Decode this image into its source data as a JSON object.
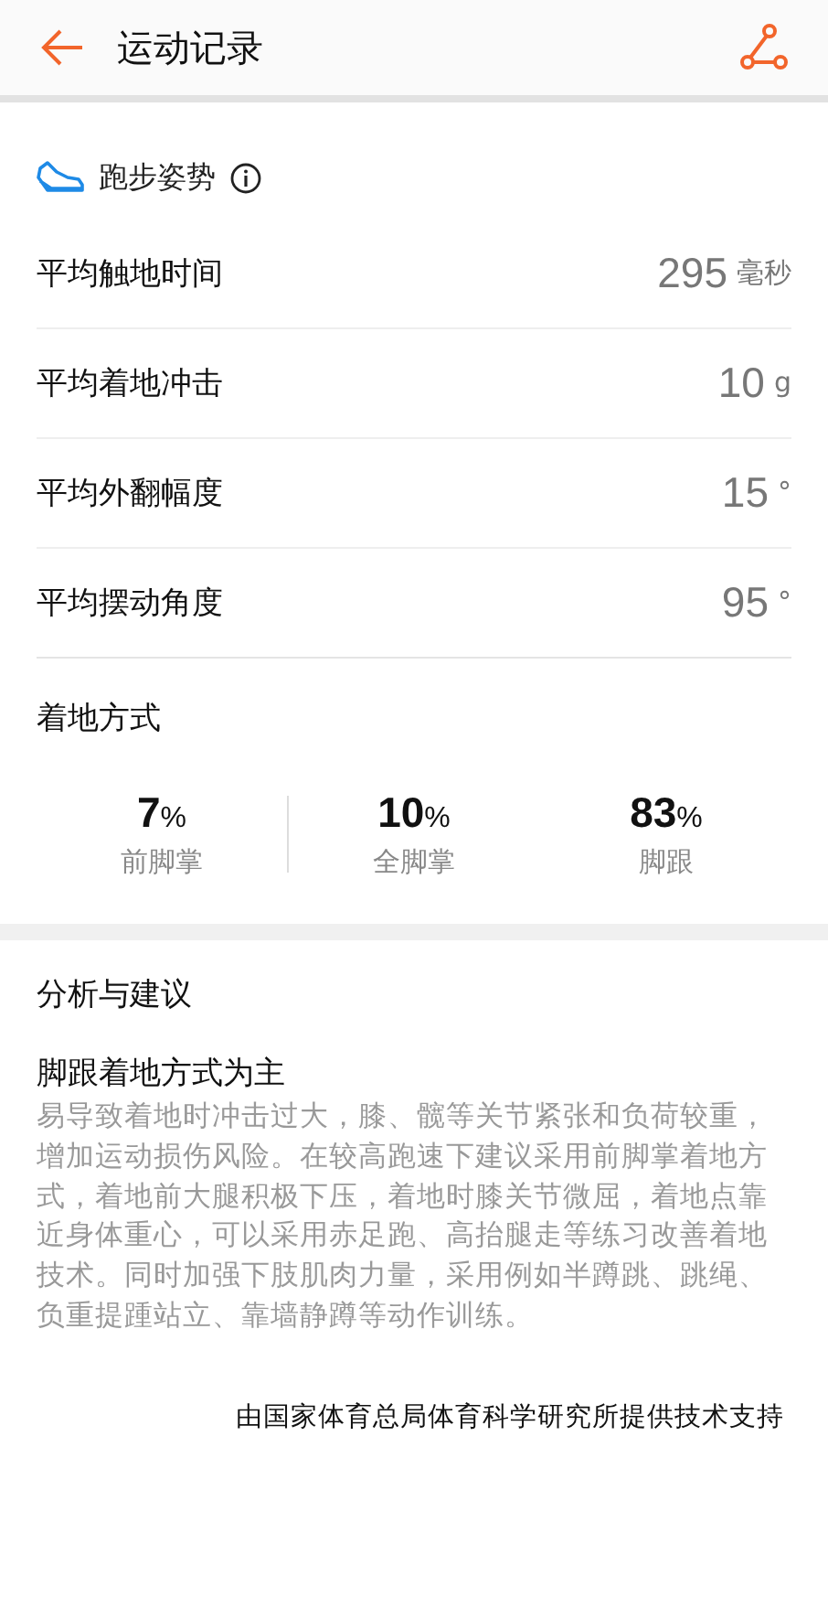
{
  "header": {
    "title": "运动记录"
  },
  "section": {
    "title": "跑步姿势"
  },
  "metrics": [
    {
      "label": "平均触地时间",
      "value": "295",
      "unit": "毫秒"
    },
    {
      "label": "平均着地冲击",
      "value": "10",
      "unit": "g"
    },
    {
      "label": "平均外翻幅度",
      "value": "15",
      "unit": "°"
    },
    {
      "label": "平均摆动角度",
      "value": "95",
      "unit": "°"
    }
  ],
  "landing": {
    "title": "着地方式",
    "stats": [
      {
        "value": "7",
        "unit": "%",
        "label": "前脚掌"
      },
      {
        "value": "10",
        "unit": "%",
        "label": "全脚掌"
      },
      {
        "value": "83",
        "unit": "%",
        "label": "脚跟"
      }
    ]
  },
  "analysis": {
    "title": "分析与建议",
    "headline": "脚跟着地方式为主",
    "body": "易导致着地时冲击过大，膝、髋等关节紧张和负荷较重，增加运动损伤风险。在较高跑速下建议采用前脚掌着地方式，着地前大腿积极下压，着地时膝关节微屈，着地点靠近身体重心，可以采用赤足跑、高抬腿走等练习改善着地技术。同时加强下肢肌肉力量，采用例如半蹲跳、跳绳、负重提踵站立、靠墙静蹲等动作训练。",
    "credit": "由国家体育总局体育科学研究所提供技术支持"
  }
}
